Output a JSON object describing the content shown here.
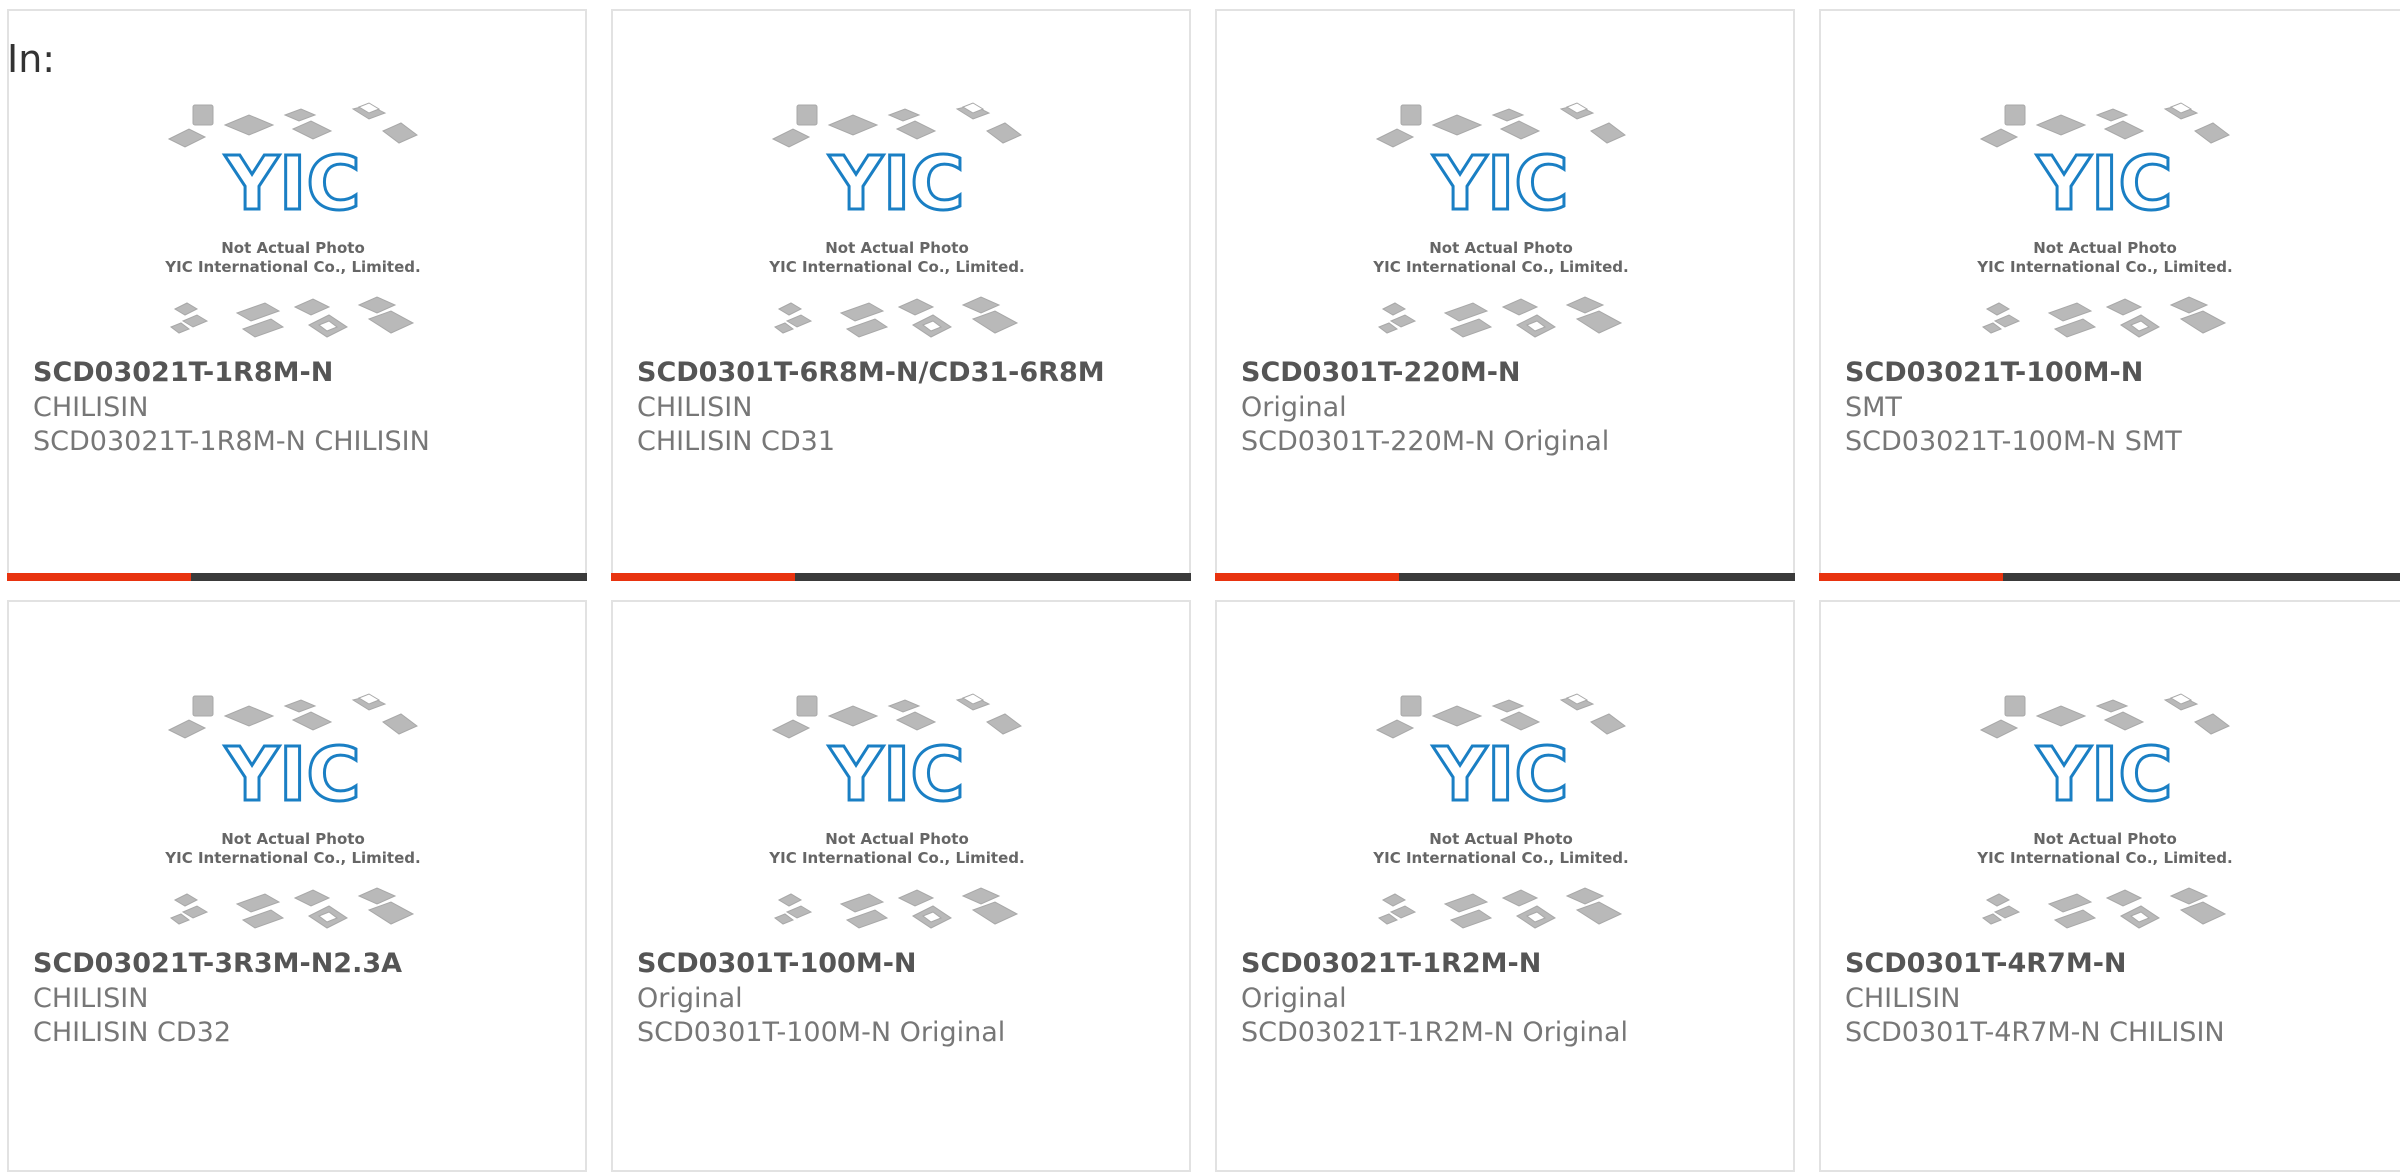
{
  "prefix_label": "In:",
  "colors": {
    "accent": "#e8330f",
    "bar": "#3a3a3a",
    "logo": "#1a7fc4"
  },
  "placeholder": {
    "logo_text": "YIC",
    "caption_line1": "Not Actual Photo",
    "caption_line2": "YIC International Co., Limited."
  },
  "cards": [
    {
      "part": "SCD03021T-1R8M-N",
      "line2": "CHILISIN",
      "line3": "SCD03021T-1R8M-N CHILISIN"
    },
    {
      "part": "SCD0301T-6R8M-N/CD31-6R8M",
      "line2": "CHILISIN",
      "line3": "CHILISIN CD31"
    },
    {
      "part": "SCD0301T-220M-N",
      "line2": "Original",
      "line3": "SCD0301T-220M-N Original"
    },
    {
      "part": "SCD03021T-100M-N",
      "line2": "SMT",
      "line3": "SCD03021T-100M-N SMT"
    },
    {
      "part": "SCD03021T-3R3M-N2.3A",
      "line2": "CHILISIN",
      "line3": "CHILISIN CD32"
    },
    {
      "part": "SCD0301T-100M-N",
      "line2": "Original",
      "line3": "SCD0301T-100M-N Original"
    },
    {
      "part": "SCD03021T-1R2M-N",
      "line2": "Original",
      "line3": "SCD03021T-1R2M-N Original"
    },
    {
      "part": "SCD0301T-4R7M-N",
      "line2": "CHILISIN",
      "line3": "SCD0301T-4R7M-N CHILISIN"
    }
  ]
}
